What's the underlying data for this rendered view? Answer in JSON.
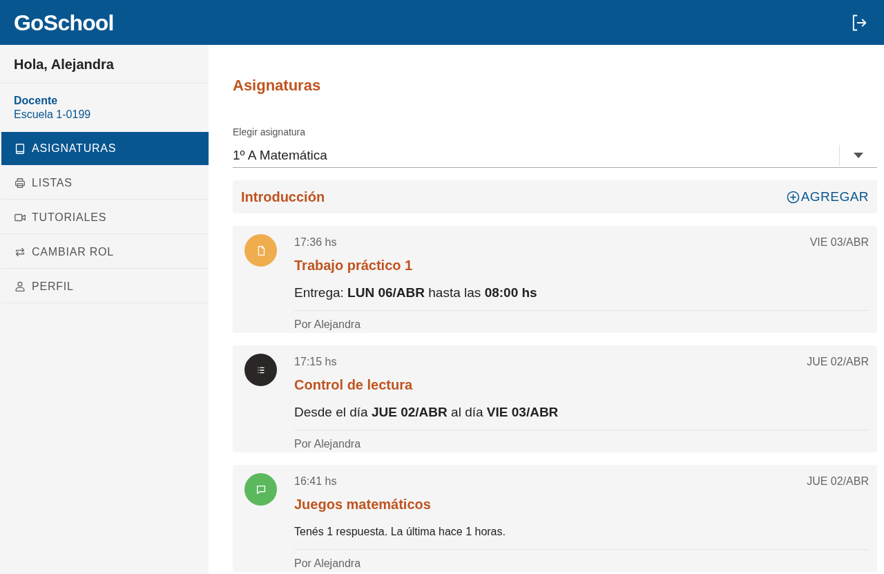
{
  "header": {
    "logo": "GoSchool"
  },
  "sidebar": {
    "greeting": "Hola, Alejandra",
    "role": "Docente",
    "school": "Escuela 1-0199",
    "items": [
      {
        "kind": "book",
        "label": "ASIGNATURAS",
        "selected": true
      },
      {
        "kind": "printer",
        "label": "LISTAS",
        "selected": false
      },
      {
        "kind": "video",
        "label": "TUTORIALES",
        "selected": false
      },
      {
        "kind": "swap",
        "label": "CAMBIAR ROL",
        "selected": false
      },
      {
        "kind": "user",
        "label": "PERFIL",
        "selected": false
      }
    ]
  },
  "main": {
    "title": "Asignaturas",
    "select": {
      "label": "Elegir asignatura",
      "value": "1º A Matemática"
    },
    "section": {
      "title": "Introducción",
      "action": "AGREGAR"
    },
    "posts": [
      {
        "kind": "assignment",
        "time": "17:36 hs",
        "date": "VIE 03/ABR",
        "title": "Trabajo práctico 1",
        "description": "Entrega: **LUN 06/ABR** hasta las **08:00 hs**",
        "author": "Por Alejandra"
      },
      {
        "kind": "reading",
        "time": "17:15 hs",
        "date": "JUE 02/ABR",
        "title": "Control de lectura",
        "description": "Desde el día **JUE 02/ABR** al día **VIE 03/ABR**",
        "author": "Por Alejandra"
      },
      {
        "kind": "forum",
        "time": "16:41 hs",
        "date": "JUE 02/ABR",
        "title": "Juegos matemáticos",
        "description": "Tenés 1 respuesta. La última hace 1 horas.",
        "author": "Por Alejandra"
      }
    ]
  }
}
